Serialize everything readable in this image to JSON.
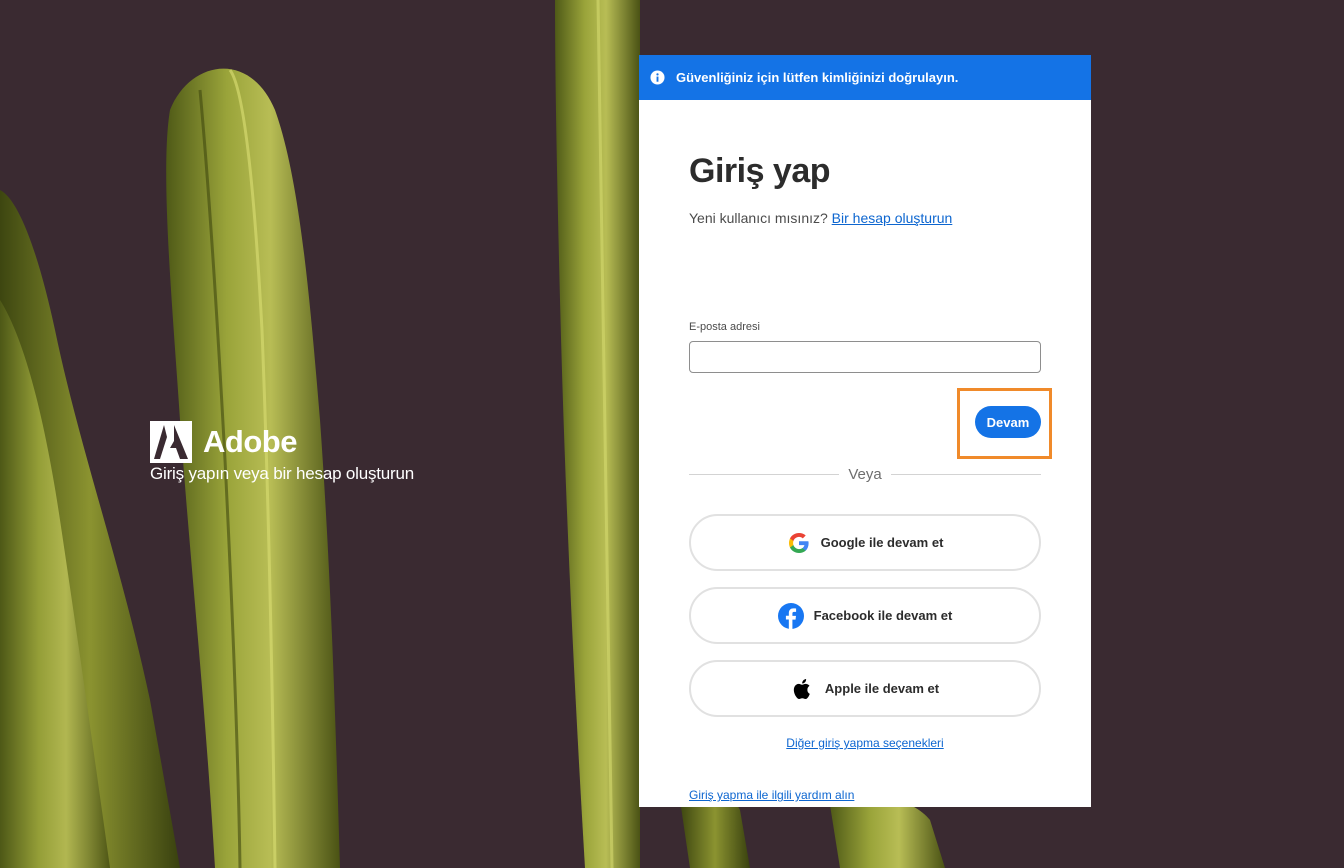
{
  "brand": {
    "logo_icon": "adobe-logo-icon",
    "name": "Adobe",
    "tagline": "Giriş yapın veya bir hesap oluşturun"
  },
  "banner": {
    "icon": "info-icon",
    "text": "Güvenliğiniz için lütfen kimliğinizi doğrulayın.",
    "color": "#1473e6"
  },
  "signin": {
    "title": "Giriş yap",
    "new_user_text": "Yeni kullanıcı mısınız?",
    "create_account_link": "Bir hesap oluşturun",
    "email_label": "E-posta adresi",
    "email_value": "",
    "continue_label": "Devam",
    "or_text": "Veya",
    "social": {
      "google": {
        "icon": "google-icon",
        "label": "Google ile devam et"
      },
      "facebook": {
        "icon": "facebook-icon",
        "label": "Facebook ile devam et"
      },
      "apple": {
        "icon": "apple-icon",
        "label": "Apple ile devam et"
      }
    },
    "other_options_link": "Diğer giriş yapma seçenekleri",
    "help_link": "Giriş yapma ile ilgili yardım alın"
  },
  "colors": {
    "accent": "#1473e6",
    "link": "#0d66d0",
    "highlight": "#f08a2a",
    "background": "#3a2a31"
  }
}
